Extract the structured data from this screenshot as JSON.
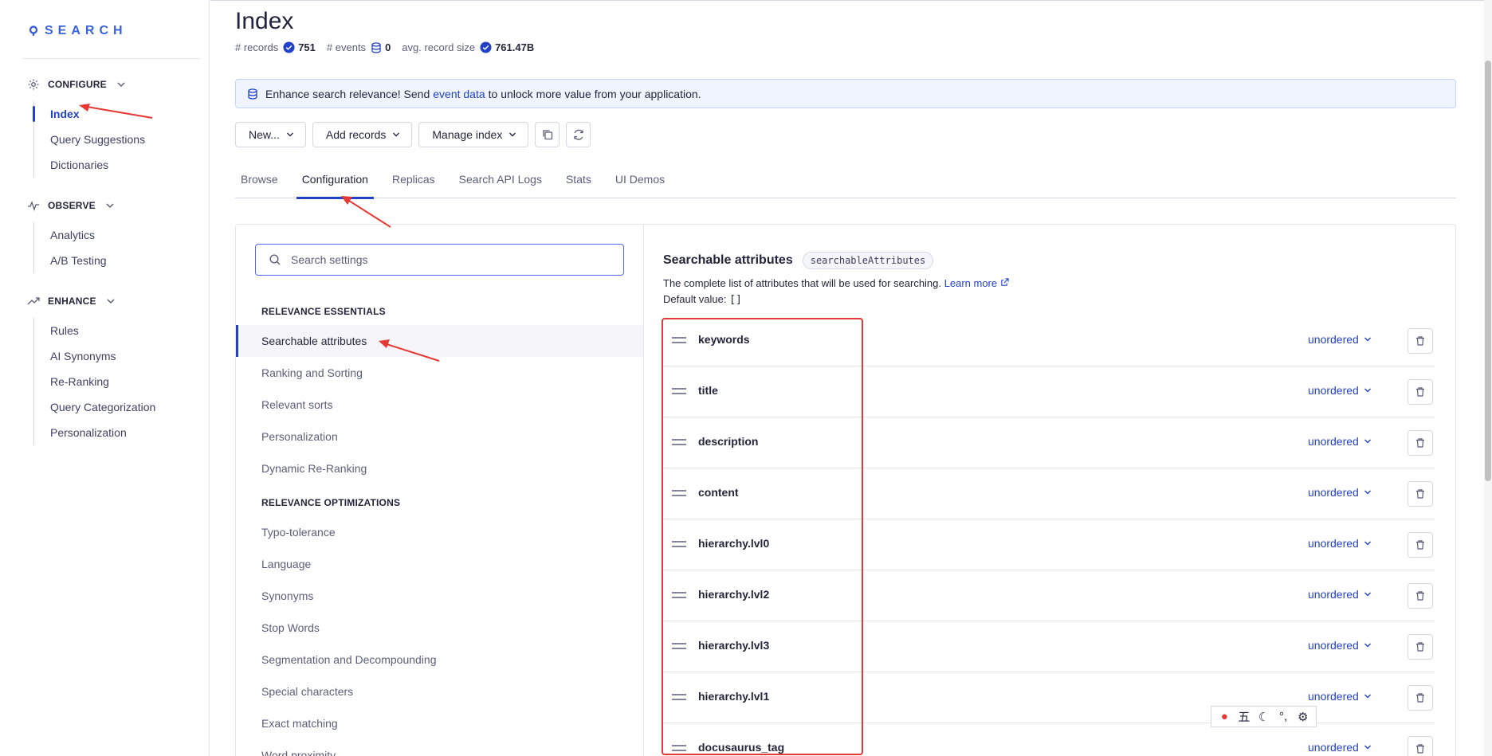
{
  "brand": {
    "name": "SEARCH",
    "color": "#3a63d9"
  },
  "sidebar": {
    "sections": [
      {
        "label": "CONFIGURE",
        "icon": "gear-icon",
        "items": [
          "Index",
          "Query Suggestions",
          "Dictionaries"
        ]
      },
      {
        "label": "OBSERVE",
        "icon": "pulse-icon",
        "items": [
          "Analytics",
          "A/B Testing"
        ]
      },
      {
        "label": "ENHANCE",
        "icon": "trend-icon",
        "items": [
          "Rules",
          "AI Synonyms",
          "Re-Ranking",
          "Query Categorization",
          "Personalization"
        ]
      }
    ],
    "active_item": "Index"
  },
  "page": {
    "title": "Index",
    "stats": {
      "records_label": "# records",
      "records_value": "751",
      "events_label": "# events",
      "events_value": "0",
      "size_label": "avg. record size",
      "size_value": "761.47B"
    }
  },
  "banner": {
    "prefix": "Enhance search relevance! Send",
    "link": "event data",
    "suffix": "to unlock more value from your application."
  },
  "toolbar": {
    "new_label": "New...",
    "add_records_label": "Add records",
    "manage_index_label": "Manage index"
  },
  "tabs": [
    "Browse",
    "Configuration",
    "Replicas",
    "Search API Logs",
    "Stats",
    "UI Demos"
  ],
  "active_tab": "Configuration",
  "settings": {
    "search_placeholder": "Search settings",
    "group1_title": "RELEVANCE ESSENTIALS",
    "group1_items": [
      "Searchable attributes",
      "Ranking and Sorting",
      "Relevant sorts",
      "Personalization",
      "Dynamic Re-Ranking"
    ],
    "group2_title": "RELEVANCE OPTIMIZATIONS",
    "group2_items": [
      "Typo-tolerance",
      "Language",
      "Synonyms",
      "Stop Words",
      "Segmentation and Decompounding",
      "Special characters",
      "Exact matching",
      "Word proximity"
    ],
    "active_item": "Searchable attributes"
  },
  "detail": {
    "title": "Searchable attributes",
    "code": "searchableAttributes",
    "description": "The complete list of attributes that will be used for searching.",
    "learn_more": "Learn more",
    "default_label": "Default value:",
    "default_value": "[]",
    "order_label": "unordered",
    "attributes": [
      "keywords",
      "title",
      "description",
      "content",
      "hierarchy.lvl0",
      "hierarchy.lvl2",
      "hierarchy.lvl3",
      "hierarchy.lvl1",
      "docusaurus_tag"
    ]
  },
  "colors": {
    "accent": "#2142c4",
    "annotation": "#e53935"
  }
}
